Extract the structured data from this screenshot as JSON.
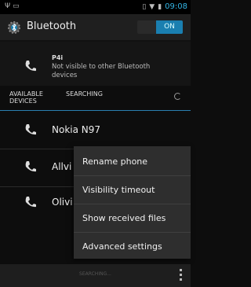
{
  "status_bar": {
    "time": "09:08"
  },
  "action_bar": {
    "title": "Bluetooth",
    "toggle_label": "ON"
  },
  "this_device": {
    "name": "P4i",
    "subtitle": "Not visible to other Bluetooth devices"
  },
  "section": {
    "available_label": "AVAILABLE DEVICES",
    "searching_label": "SEARCHING"
  },
  "devices": [
    {
      "label": "Nokia N97"
    },
    {
      "label": "Allvi"
    },
    {
      "label": "Olivi"
    }
  ],
  "menu": {
    "items": [
      {
        "label": "Rename phone"
      },
      {
        "label": "Visibility timeout"
      },
      {
        "label": "Show received files"
      },
      {
        "label": "Advanced settings"
      }
    ]
  },
  "bottom_bar": {
    "label": "SEARCHING..."
  },
  "colors": {
    "accent": "#33b5e5",
    "toggle_on": "#1a7fb0"
  }
}
